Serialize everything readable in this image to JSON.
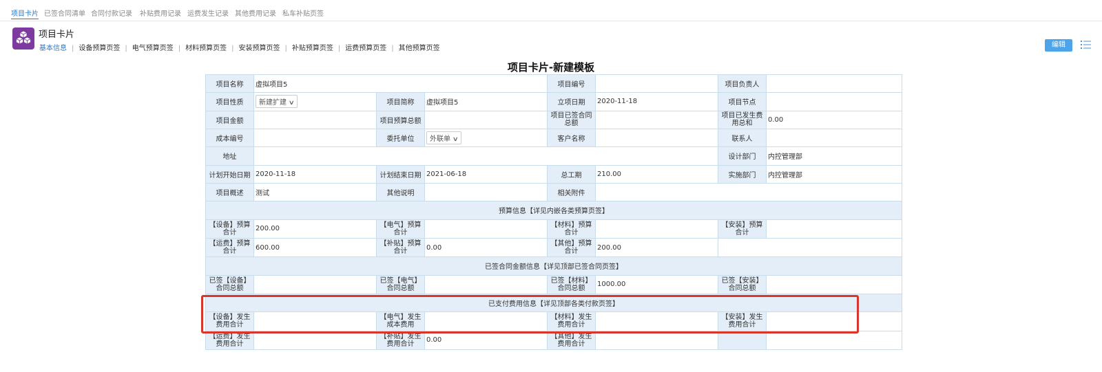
{
  "top_tabs": [
    "项目卡片",
    "已签合同清单",
    "合同付款记录",
    "补贴费用记录",
    "运费发生记录",
    "其他费用记录",
    "私车补贴页签"
  ],
  "card": {
    "title": "项目卡片",
    "icon": "cubes-icon"
  },
  "sub_tabs": [
    "基本信息",
    "设备预算页签",
    "电气预算页签",
    "材料预算页签",
    "安装预算页签",
    "补贴预算页签",
    "运费预算页签",
    "其他预算页签"
  ],
  "toolbar": {
    "edit_label": "编辑",
    "menu_icon": "list-icon"
  },
  "heading": "项目卡片-新建模板",
  "fields": {
    "project_name": {
      "label": "项目名称",
      "value": "虚拟项目5"
    },
    "project_no": {
      "label": "项目编号",
      "value": ""
    },
    "project_manager": {
      "label": "项目负责人",
      "value": ""
    },
    "project_nature": {
      "label": "项目性质",
      "value": "新建扩建"
    },
    "project_short": {
      "label": "项目简称",
      "value": "虚拟项目5"
    },
    "setup_date": {
      "label": "立项日期",
      "value": "2020-11-18"
    },
    "project_node": {
      "label": "项目节点",
      "value": ""
    },
    "project_amount": {
      "label": "项目金额",
      "value": ""
    },
    "budget_total": {
      "label": "项目预算总额",
      "value": ""
    },
    "signed_total": {
      "label": "项目已签合同总额",
      "value": ""
    },
    "expense_total": {
      "label": "项目已发生费用总和",
      "value": "0.00"
    },
    "cost_no": {
      "label": "成本编号",
      "value": ""
    },
    "entrust_unit": {
      "label": "委托单位",
      "value": "外联单"
    },
    "client_name": {
      "label": "客户名称",
      "value": ""
    },
    "contact": {
      "label": "联系人",
      "value": ""
    },
    "address": {
      "label": "地址",
      "value": ""
    },
    "design_dept": {
      "label": "设计部门",
      "value": "内控管理部"
    },
    "plan_start": {
      "label": "计划开始日期",
      "value": "2020-11-18"
    },
    "plan_end": {
      "label": "计划结束日期",
      "value": "2021-06-18"
    },
    "total_days": {
      "label": "总工期",
      "value": "210.00"
    },
    "impl_dept": {
      "label": "实施部门",
      "value": "内控管理部"
    },
    "overview": {
      "label": "项目概述",
      "value": "测试"
    },
    "other_desc": {
      "label": "其他说明",
      "value": ""
    },
    "attachments": {
      "label": "相关附件",
      "value": ""
    }
  },
  "budget_section": {
    "title": "预算信息【详见内嵌各类预算页签】",
    "rows": [
      [
        {
          "label": "【设备】预算合计",
          "value": "200.00"
        },
        {
          "label": "【电气】预算合计",
          "value": ""
        },
        {
          "label": "【材料】预算合计",
          "value": ""
        },
        {
          "label": "【安装】预算合计",
          "value": ""
        }
      ],
      [
        {
          "label": "【运费】预算合计",
          "value": "600.00"
        },
        {
          "label": "【补贴】预算合计",
          "value": "0.00"
        },
        {
          "label": "【其他】预算合计",
          "value": "200.00"
        }
      ]
    ]
  },
  "signed_section": {
    "title": "已签合同金额信息【详见顶部已签合同页签】",
    "rows": [
      [
        {
          "label": "已签【设备】合同总额",
          "value": ""
        },
        {
          "label": "已签【电气】合同总额",
          "value": ""
        },
        {
          "label": "已签【材料】合同总额",
          "value": "1000.00"
        },
        {
          "label": "已签【安装】合同总额",
          "value": ""
        }
      ]
    ]
  },
  "paid_section": {
    "title": "已支付费用信息【详见顶部各类付款页签】",
    "rows": [
      [
        {
          "label": "【设备】发生费用合计",
          "value": ""
        },
        {
          "label": "【电气】发生成本费用",
          "value": ""
        },
        {
          "label": "【材料】发生费用合计",
          "value": ""
        },
        {
          "label": "【安装】发生费用合计",
          "value": ""
        }
      ],
      [
        {
          "label": "【运费】发生费用合计",
          "value": ""
        },
        {
          "label": "【补贴】发生费用合计",
          "value": "0.00"
        },
        {
          "label": "【其他】发生费用合计",
          "value": ""
        }
      ]
    ]
  },
  "colors": {
    "accent": "#2a78c8",
    "edit_button": "#4da4e8",
    "label_bg": "#e4eef8",
    "highlight": "#d9362b",
    "icon_bg": "#7d3a9f"
  }
}
